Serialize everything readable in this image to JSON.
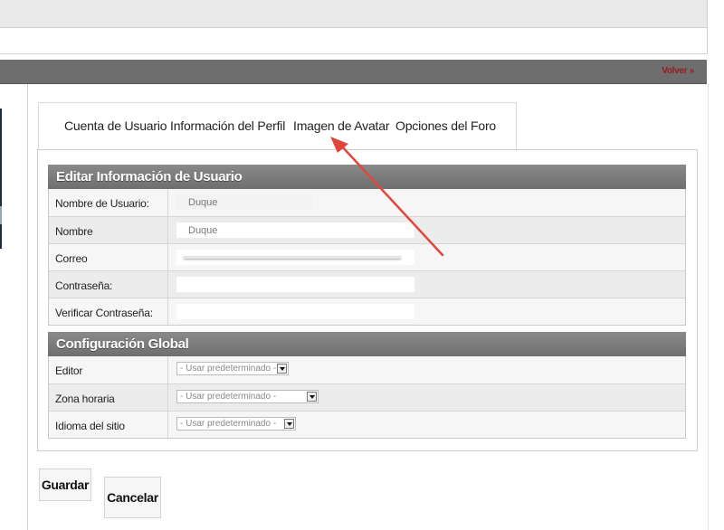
{
  "header": {
    "volver_label": "Volver »"
  },
  "tabs": [
    {
      "label": "Cuenta de Usuario"
    },
    {
      "label": "Información del Perfil"
    },
    {
      "label": "Imagen de Avatar"
    },
    {
      "label": "Opciones del Foro"
    }
  ],
  "user_section": {
    "title": "Editar Información de Usuario",
    "rows": [
      {
        "label": "Nombre de Usuario:",
        "value": "Duque"
      },
      {
        "label": "Nombre",
        "value": "Duque"
      },
      {
        "label": "Correo",
        "value": ""
      },
      {
        "label": "Contraseña:",
        "value": ""
      },
      {
        "label": "Verificar Contraseña:",
        "value": ""
      }
    ]
  },
  "global_section": {
    "title": "Configuración Global",
    "rows": [
      {
        "label": "Editor",
        "selected": "- Usar predeterminado -"
      },
      {
        "label": "Zona horaria",
        "selected": "- Usar predeterminado -"
      },
      {
        "label": "Idioma del sitio",
        "selected": "- Usar predeterminado -"
      }
    ]
  },
  "buttons": {
    "save_label": "Guardar",
    "cancel_label": "Cancelar"
  },
  "colors": {
    "accent_red": "#e0473a",
    "link_red": "#9b1b1b",
    "header_gray": "#6e6e6e"
  }
}
